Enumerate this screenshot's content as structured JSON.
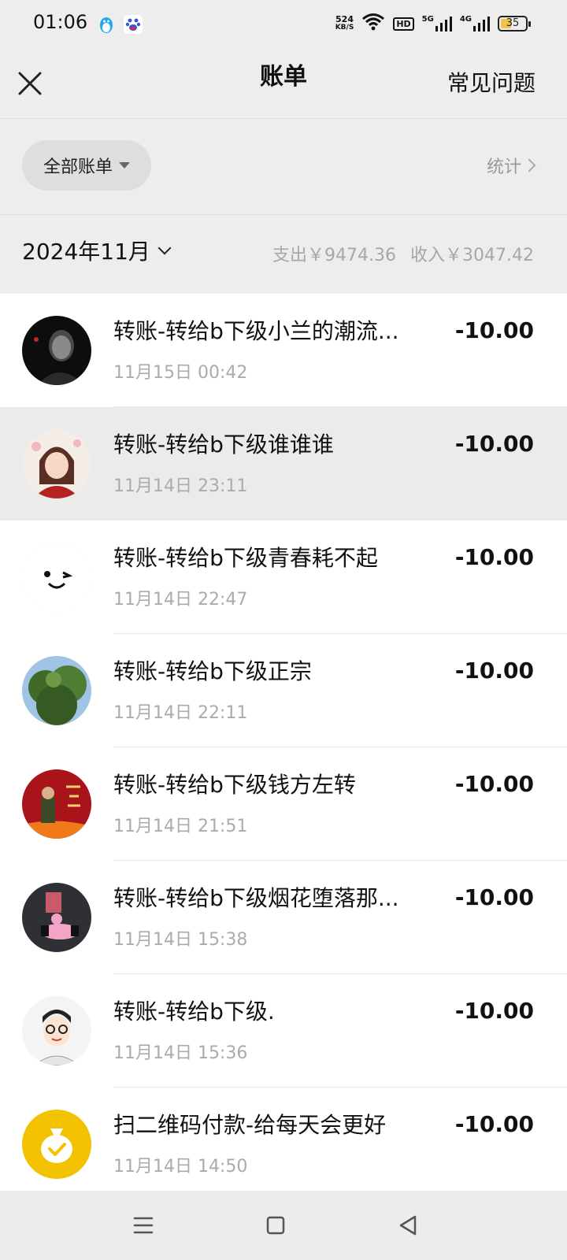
{
  "status_bar": {
    "time": "01:06",
    "speed_value": "524",
    "speed_unit": "KB/S",
    "hd_badge": "HD",
    "net1": "5G",
    "net2": "4G",
    "battery": "35"
  },
  "header": {
    "title": "账单",
    "faq_label": "常见问题"
  },
  "filter": {
    "category_label": "全部账单",
    "stats_label": "统计"
  },
  "month_bar": {
    "month_label": "2024年11月",
    "expense": "支出￥9474.36",
    "income": "收入￥3047.42"
  },
  "bills": [
    {
      "title": "转账-转给b下级小兰的潮流...",
      "time": "11月15日 00:42",
      "amount": "-10.00"
    },
    {
      "title": "转账-转给b下级谁谁谁",
      "time": "11月14日 23:11",
      "amount": "-10.00"
    },
    {
      "title": "转账-转给b下级青春耗不起",
      "time": "11月14日 22:47",
      "amount": "-10.00"
    },
    {
      "title": "转账-转给b下级正宗",
      "time": "11月14日 22:11",
      "amount": "-10.00"
    },
    {
      "title": "转账-转给b下级钱方左转",
      "time": "11月14日 21:51",
      "amount": "-10.00"
    },
    {
      "title": "转账-转给b下级烟花堕落那...",
      "time": "11月14日 15:38",
      "amount": "-10.00"
    },
    {
      "title": "转账-转给b下级.",
      "time": "11月14日 15:36",
      "amount": "-10.00"
    },
    {
      "title": "扫二维码付款-给每天会更好",
      "time": "11月14日 14:50",
      "amount": "-10.00"
    }
  ]
}
